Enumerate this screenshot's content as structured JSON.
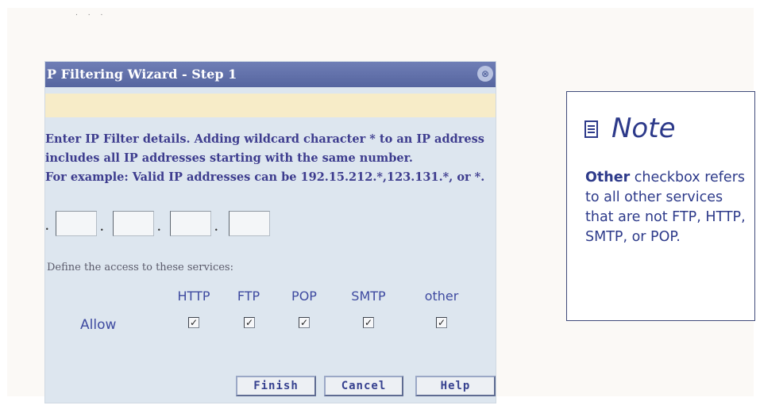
{
  "dialog": {
    "title": "P Filtering Wizard - Step 1",
    "close_symbol": "⊗",
    "instructions": [
      "Enter IP Filter details. Adding wildcard character * to an IP address",
      "includes all IP addresses starting with the same number.",
      "For example: Valid IP addresses can be 192.15.212.*,123.131.*, or *."
    ],
    "ip_octets": [
      "",
      "",
      "",
      ""
    ],
    "services_label": "Define the access to these services:",
    "services": [
      "HTTP",
      "FTP",
      "POP",
      "SMTP",
      "other"
    ],
    "allow_label": "Allow",
    "allow_checked": [
      true,
      true,
      true,
      true,
      true
    ],
    "check_glyph": "✓",
    "buttons": {
      "finish": "Finish",
      "cancel": "Cancel",
      "help": "Help"
    }
  },
  "note": {
    "icon": "document-icon",
    "title": "Note",
    "bold_word": "Other",
    "text": " checkbox refers to all other services that are not FTP, HTTP, SMTP, or POP."
  },
  "colors": {
    "titlebar": "#5f6ea8",
    "dialog_bg": "#dde6ef",
    "info_bar": "#f7ecc8",
    "text_blue": "#3e4aa0",
    "note_border": "#404b7a"
  }
}
